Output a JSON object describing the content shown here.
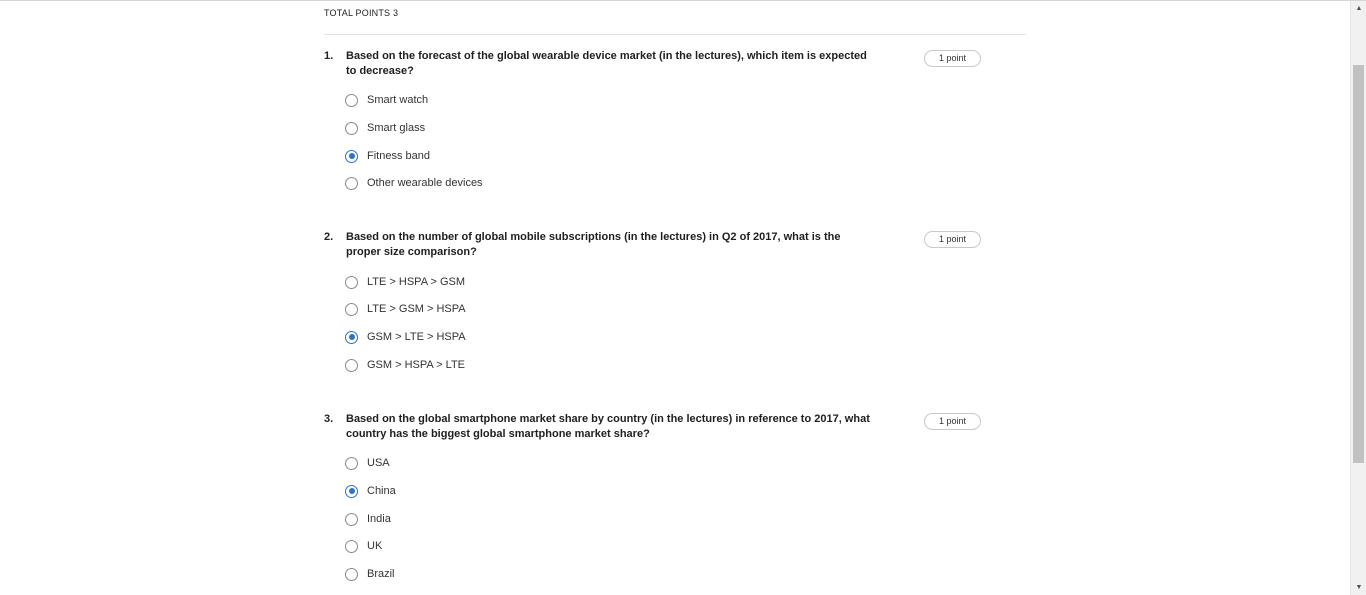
{
  "quiz": {
    "total_points_label": "TOTAL POINTS 3",
    "questions": [
      {
        "number": "1.",
        "text": "Based on the forecast of the global wearable device market (in the lectures), which item is expected to decrease?",
        "points": "1 point",
        "options": [
          "Smart watch",
          "Smart glass",
          "Fitness band",
          "Other wearable devices"
        ],
        "selected": "Fitness band"
      },
      {
        "number": "2.",
        "text": "Based on the number of global mobile subscriptions (in the lectures) in Q2 of 2017, what is the proper size comparison?",
        "points": "1 point",
        "options": [
          "LTE > HSPA > GSM",
          "LTE > GSM > HSPA",
          "GSM > LTE > HSPA",
          "GSM > HSPA > LTE"
        ],
        "selected": "GSM > LTE > HSPA"
      },
      {
        "number": "3.",
        "text": "Based on the global smartphone market share by country (in the lectures) in reference to 2017, what country has the biggest global smartphone market share?",
        "points": "1 point",
        "options": [
          "USA",
          "China",
          "India",
          "UK",
          "Brazil"
        ],
        "selected": "China"
      }
    ]
  },
  "scrollbar": {
    "up_icon": "triangle-up-icon",
    "down_icon": "triangle-down-icon"
  },
  "colors": {
    "accent": "#2a73cc",
    "divider": "#e1e1e1"
  }
}
